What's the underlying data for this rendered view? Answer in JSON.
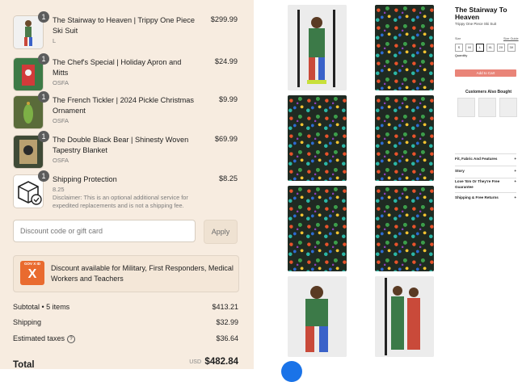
{
  "cart": {
    "items": [
      {
        "name": "The Stairway to Heaven | Trippy One Piece Ski Suit",
        "variant": "L",
        "price": "$299.99",
        "qty": "1"
      },
      {
        "name": "The Chef's Special | Holiday Apron and Mitts",
        "variant": "OSFA",
        "price": "$24.99",
        "qty": "1"
      },
      {
        "name": "The French Tickler | 2024 Pickle Christmas Ornament",
        "variant": "OSFA",
        "price": "$9.99",
        "qty": "1"
      },
      {
        "name": "The Double Black Bear | Shinesty Woven Tapestry Blanket",
        "variant": "OSFA",
        "price": "$69.99",
        "qty": "1"
      },
      {
        "name": "Shipping Protection",
        "variant": "8.25",
        "price": "$8.25",
        "qty": "1",
        "disclaimer": "Disclaimer: This is an optional additional service for expedited replacements and is not a shipping fee."
      }
    ]
  },
  "discount": {
    "placeholder": "Discount code or gift card",
    "apply_label": "Apply"
  },
  "gov_banner": {
    "logo_top": "GOV X ID",
    "logo_mark": "X",
    "text": "Discount available for Military, First Responders, Medical Workers and Teachers"
  },
  "summary": {
    "subtotal_label": "Subtotal • 5 items",
    "subtotal": "$413.21",
    "shipping_label": "Shipping",
    "shipping": "$32.99",
    "taxes_label": "Estimated taxes",
    "taxes": "$36.64",
    "total_label": "Total",
    "currency": "USD",
    "total": "$482.84"
  },
  "product": {
    "title": "The Stairway To Heaven",
    "subtitle": "Trippy One Piece Ski Suit",
    "sizes": [
      "S",
      "M",
      "L",
      "XL",
      "2X",
      "3X"
    ],
    "size_label": "Size",
    "size_guide": "Size Guide",
    "quantity_label": "Quantity",
    "add_to_cart": "Add to Cart",
    "also_bought": "Customers Also Bought",
    "accordions": [
      "Fit, Fabric And Features",
      "Story",
      "Love 'Em Or They're Free Guarantee",
      "Shipping & Free Returns"
    ]
  },
  "colors": {
    "panel_bg": "#f7ece0",
    "accent": "#e98478",
    "govx": "#e96b2f"
  }
}
